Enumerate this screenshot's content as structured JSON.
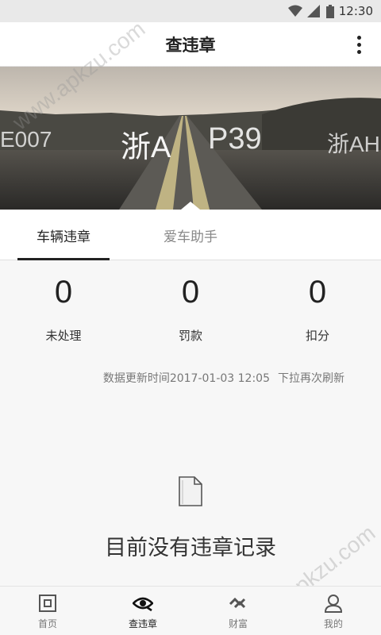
{
  "status_bar": {
    "time": "12:30",
    "icons": [
      "wifi-icon",
      "signal-icon",
      "battery-icon"
    ]
  },
  "app_bar": {
    "title": "查违章",
    "menu_icon": "more-vert-icon"
  },
  "banner": {
    "plate_left": "E007",
    "plate_center": "浙A",
    "plate_mid": "P39",
    "plate_right": "浙AH"
  },
  "tabs": [
    {
      "label": "车辆违章",
      "active": true
    },
    {
      "label": "爱车助手",
      "active": false
    }
  ],
  "stats": [
    {
      "value": "0",
      "label": "未处理"
    },
    {
      "value": "0",
      "label": "罚款"
    },
    {
      "value": "0",
      "label": "扣分"
    }
  ],
  "update": {
    "time_text": "数据更新时间2017-01-03 12:05",
    "refresh_hint": "下拉再次刷新"
  },
  "empty_state": {
    "icon": "document-icon",
    "text": "目前没有违章记录"
  },
  "watermark": "www.apkzu.com",
  "bottom_nav": [
    {
      "label": "首页",
      "icon": "home-icon",
      "active": false
    },
    {
      "label": "查违章",
      "icon": "eye-icon",
      "active": true
    },
    {
      "label": "财富",
      "icon": "wealth-icon",
      "active": false
    },
    {
      "label": "我的",
      "icon": "user-icon",
      "active": false
    }
  ],
  "colors": {
    "accent": "#222222",
    "muted": "#888888",
    "background": "#f7f7f7"
  }
}
